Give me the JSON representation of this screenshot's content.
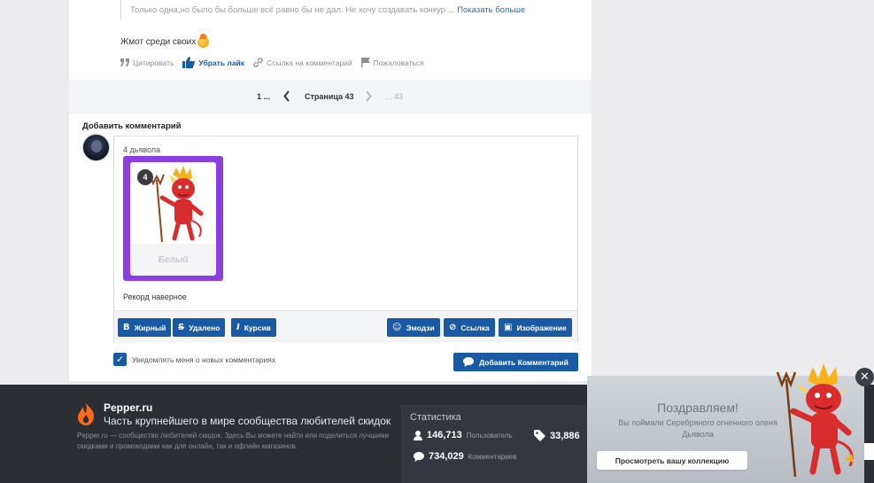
{
  "comment": {
    "quote_text": "Только одна,но было бы больше всё равно бы не дал. Не хочу создавать конкур ...",
    "quote_more": "Показать больше",
    "text": "Жмот среди своих",
    "actions": {
      "quote": "Цитировать",
      "unlike": "Убрать лайк",
      "link": "Ссылка на комментарий",
      "report": "Пожаловаться"
    }
  },
  "pagination": {
    "first": "1 ...",
    "current": "Страница 43",
    "last": "... 43"
  },
  "add_comment": {
    "title": "Добавить комментарий",
    "attachment_label": "4 дьявола",
    "card": {
      "count": "4",
      "name": "Белый",
      "color": "#8c3fe0"
    },
    "body_text": "Рекорд наверное",
    "toolbar": {
      "bold": "Жирный",
      "strike": "Удалено",
      "italic": "Курсив",
      "emoji": "Эмодзи",
      "link": "Ссылка",
      "image": "Изображение"
    },
    "notify_label": "Уведомлять меня о новых комментариях",
    "submit_label": "Добавить Комментарий"
  },
  "footer": {
    "brand": "Pepper.ru",
    "tagline": "Часть крупнейшего в мире сообщества любителей скидок",
    "about": "Pepper.ru — сообщество любителей скидок. Здесь Вы можете найти или поделиться лучшими скидками и промокодами как для онлайн, так и офлайн магазинов.",
    "stats": {
      "title": "Статистика",
      "users_num": "146,713",
      "users_label": "Пользователь",
      "deals_num": "33,886",
      "comments_num": "734,029",
      "comments_label": "Комментариев"
    }
  },
  "popup": {
    "title": "Поздравляем!",
    "text": "Вы поймали Серебряного огненного оленя Дьявола",
    "button": "Просмотреть вашу коллекцию",
    "close": "✕"
  },
  "colors": {
    "accent": "#1a5aa5",
    "footer_bg": "#2b2e33"
  }
}
